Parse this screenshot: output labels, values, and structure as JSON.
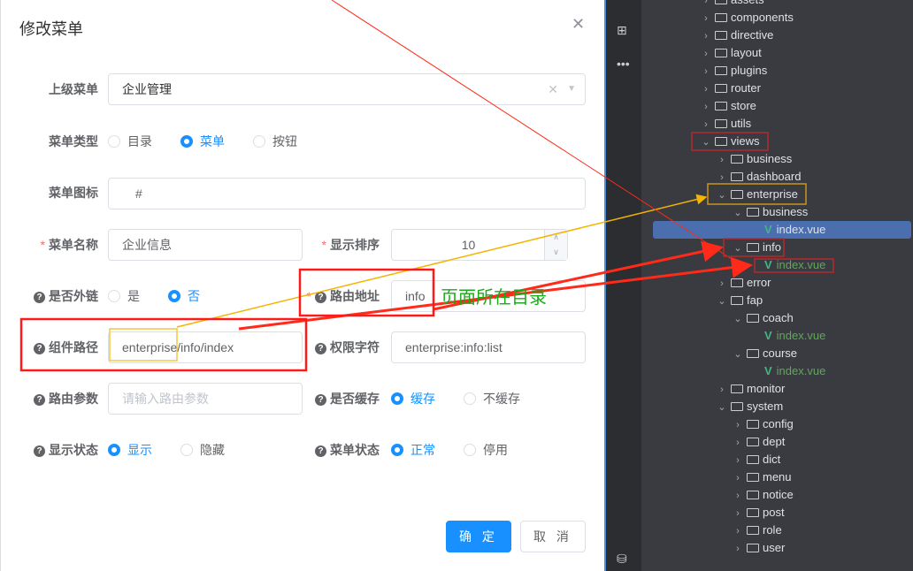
{
  "dialog": {
    "title": "修改菜单",
    "close_icon": "close-icon",
    "parent_menu": {
      "label": "上级菜单",
      "value": "企业管理"
    },
    "menu_type": {
      "label": "菜单类型",
      "options": [
        "目录",
        "菜单",
        "按钮"
      ],
      "selected": "菜单"
    },
    "menu_icon": {
      "label": "菜单图标",
      "value": "#"
    },
    "menu_name": {
      "label": "菜单名称",
      "value": "企业信息"
    },
    "sort": {
      "label": "显示排序",
      "value": "10"
    },
    "external": {
      "label": "是否外链",
      "options": [
        "是",
        "否"
      ],
      "selected": "否"
    },
    "route_path": {
      "label": "路由地址",
      "value": "info"
    },
    "component": {
      "label": "组件路径",
      "value": "enterprise/info/index"
    },
    "perms": {
      "label": "权限字符",
      "value": "enterprise:info:list"
    },
    "query": {
      "label": "路由参数",
      "placeholder": "请输入路由参数"
    },
    "cache": {
      "label": "是否缓存",
      "options": [
        "缓存",
        "不缓存"
      ],
      "selected": "缓存"
    },
    "visible": {
      "label": "显示状态",
      "options": [
        "显示",
        "隐藏"
      ],
      "selected": "显示"
    },
    "status": {
      "label": "菜单状态",
      "options": [
        "正常",
        "停用"
      ],
      "selected": "正常"
    },
    "confirm": "确 定",
    "cancel": "取 消"
  },
  "annotation": "页面所在目录",
  "accent": "#1890ff",
  "tree": [
    {
      "name": "assets",
      "level": 1,
      "type": "folder",
      "open": false
    },
    {
      "name": "components",
      "level": 1,
      "type": "folder",
      "open": false
    },
    {
      "name": "directive",
      "level": 1,
      "type": "folder",
      "open": false
    },
    {
      "name": "layout",
      "level": 1,
      "type": "folder",
      "open": false
    },
    {
      "name": "plugins",
      "level": 1,
      "type": "folder",
      "open": false
    },
    {
      "name": "router",
      "level": 1,
      "type": "folder",
      "open": false
    },
    {
      "name": "store",
      "level": 1,
      "type": "folder",
      "open": false
    },
    {
      "name": "utils",
      "level": 1,
      "type": "folder",
      "open": false
    },
    {
      "name": "views",
      "level": 1,
      "type": "folder",
      "open": true
    },
    {
      "name": "business",
      "level": 2,
      "type": "folder",
      "open": false
    },
    {
      "name": "dashboard",
      "level": 2,
      "type": "folder",
      "open": false
    },
    {
      "name": "enterprise",
      "level": 2,
      "type": "folder",
      "open": true
    },
    {
      "name": "business",
      "level": 3,
      "type": "folder",
      "open": true
    },
    {
      "name": "index.vue",
      "level": 4,
      "type": "vue",
      "selected": true
    },
    {
      "name": "info",
      "level": 3,
      "type": "folder",
      "open": true
    },
    {
      "name": "index.vue",
      "level": 4,
      "type": "vue"
    },
    {
      "name": "error",
      "level": 2,
      "type": "folder",
      "open": false
    },
    {
      "name": "fap",
      "level": 2,
      "type": "folder",
      "open": true
    },
    {
      "name": "coach",
      "level": 3,
      "type": "folder",
      "open": true
    },
    {
      "name": "index.vue",
      "level": 4,
      "type": "vue"
    },
    {
      "name": "course",
      "level": 3,
      "type": "folder",
      "open": true
    },
    {
      "name": "index.vue",
      "level": 4,
      "type": "vue"
    },
    {
      "name": "monitor",
      "level": 2,
      "type": "folder",
      "open": false
    },
    {
      "name": "system",
      "level": 2,
      "type": "folder",
      "open": true
    },
    {
      "name": "config",
      "level": 3,
      "type": "folder",
      "open": false
    },
    {
      "name": "dept",
      "level": 3,
      "type": "folder",
      "open": false
    },
    {
      "name": "dict",
      "level": 3,
      "type": "folder",
      "open": false
    },
    {
      "name": "menu",
      "level": 3,
      "type": "folder",
      "open": false
    },
    {
      "name": "notice",
      "level": 3,
      "type": "folder",
      "open": false
    },
    {
      "name": "post",
      "level": 3,
      "type": "folder",
      "open": false
    },
    {
      "name": "role",
      "level": 3,
      "type": "folder",
      "open": false
    },
    {
      "name": "user",
      "level": 3,
      "type": "folder",
      "open": false
    }
  ]
}
